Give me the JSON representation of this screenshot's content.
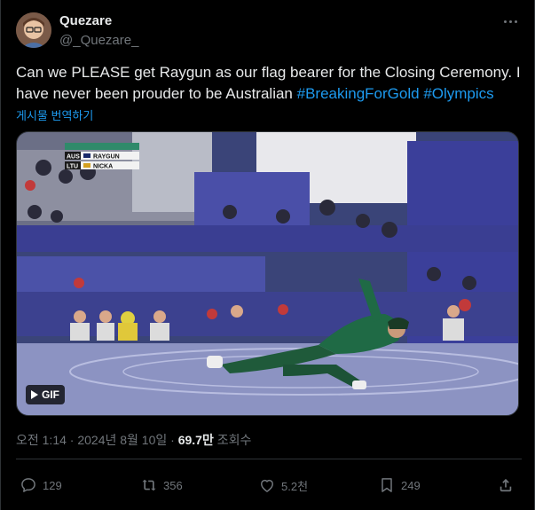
{
  "author": {
    "display_name": "Quezare",
    "handle": "@_Quezare_"
  },
  "tweet": {
    "text_part": "Can we PLEASE get Raygun as our flag bearer for the Closing Ceremony. I have never been prouder to be Australian ",
    "hashtag_1": "#BreakingForGold",
    "hashtag_2": "#Olympics",
    "translate_label": "게시물 번역하기"
  },
  "media": {
    "gif_label": "GIF",
    "scoreboard": {
      "row1_country": "AUS",
      "row1_name": "RAYGUN",
      "row2_country": "LTU",
      "row2_name": "NICKA"
    }
  },
  "meta": {
    "timestamp": "오전 1:14 · 2024년 8월 10일 · ",
    "views_count": "69.7만",
    "views_label": " 조회수"
  },
  "actions": {
    "reply_count": "129",
    "repost_count": "356",
    "like_count": "5.2천",
    "bookmark_count": "249"
  },
  "colors": {
    "background": "#000000",
    "text": "#e7e9ea",
    "secondary": "#71767b",
    "link": "#1d9bf0",
    "border": "#2f3336"
  }
}
